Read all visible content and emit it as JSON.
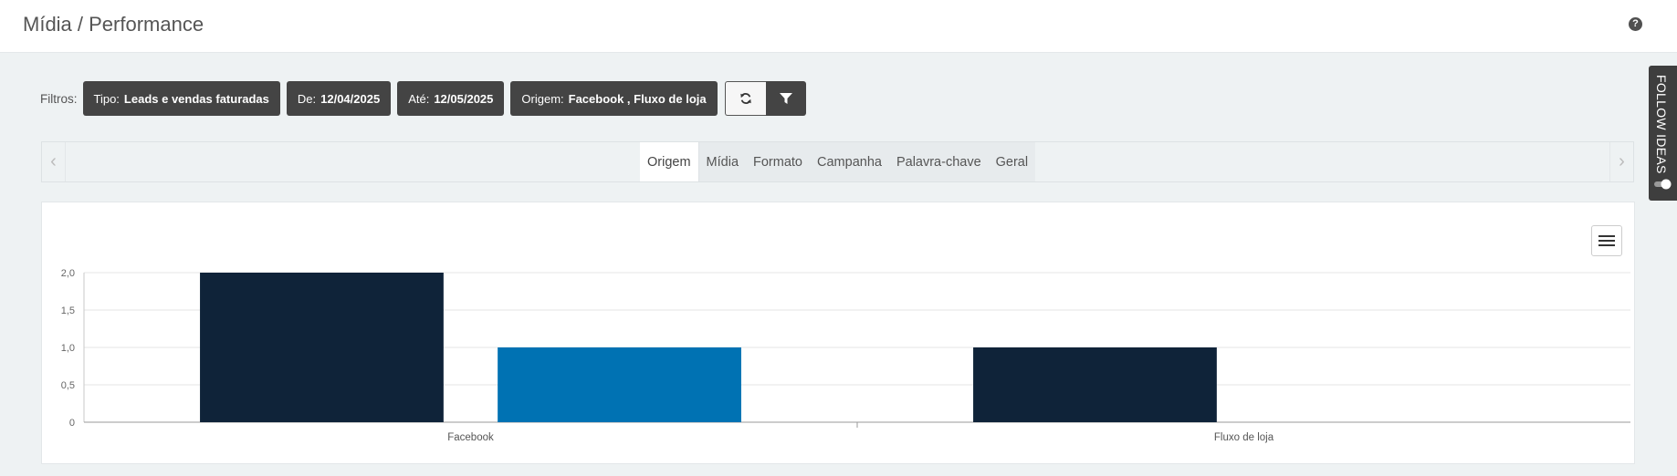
{
  "header": {
    "title": "Mídia / Performance",
    "help_glyph": "?"
  },
  "filters": {
    "label": "Filtros:",
    "chips": [
      {
        "key": "Tipo:",
        "value": "Leads e vendas faturadas"
      },
      {
        "key": "De:",
        "value": "12/04/2025"
      },
      {
        "key": "Até:",
        "value": "12/05/2025"
      },
      {
        "key": "Origem:",
        "value": "Facebook , Fluxo de loja"
      }
    ],
    "refresh_icon": "refresh-icon",
    "filter_icon": "funnel-icon"
  },
  "tabs": {
    "items": [
      {
        "label": "Origem",
        "active": true
      },
      {
        "label": "Mídia",
        "active": false
      },
      {
        "label": "Formato",
        "active": false
      },
      {
        "label": "Campanha",
        "active": false
      },
      {
        "label": "Palavra-chave",
        "active": false
      },
      {
        "label": "Geral",
        "active": false
      }
    ],
    "prev_glyph": "‹",
    "next_glyph": "›"
  },
  "side_tab": {
    "label": "FOLLOW IDEAS"
  },
  "colors": {
    "series_dark": "#0f2339",
    "series_blue": "#0072b3",
    "chip_bg": "#444444",
    "grid": "#e6e6e6"
  },
  "chart_data": {
    "type": "bar",
    "categories": [
      "Facebook",
      "Fluxo de loja"
    ],
    "series": [
      {
        "values": [
          2,
          1
        ],
        "color": "#0f2339"
      },
      {
        "values": [
          1,
          0
        ],
        "color": "#0072b3"
      }
    ],
    "ylim": [
      0,
      2
    ],
    "yticks": [
      "0",
      "0,5",
      "1,0",
      "1,5",
      "2,0"
    ],
    "ytick_values": [
      0,
      0.5,
      1,
      1.5,
      2
    ],
    "grid": true,
    "legend": "none"
  }
}
